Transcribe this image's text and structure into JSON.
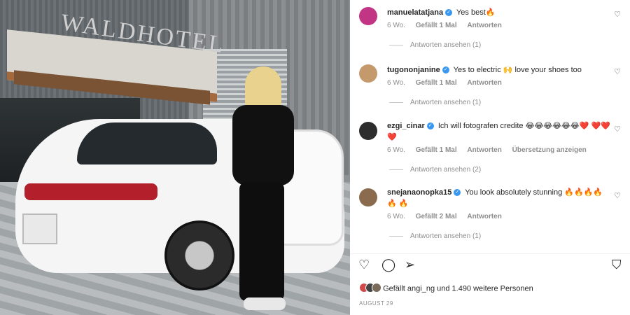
{
  "photo": {
    "sign_text": "WALDHOTEL"
  },
  "comments": [
    {
      "username": "manuelatatjana",
      "verified": true,
      "text": "Yes best🔥",
      "time": "6 Wo.",
      "likes": "Gefällt 1 Mal",
      "reply": "Antworten",
      "translate": "",
      "view_replies": "Antworten ansehen (1)",
      "avatar_color": "#c13584"
    },
    {
      "username": "tugononjanine",
      "verified": true,
      "text": "Yes to electric 🙌 love your shoes too",
      "time": "6 Wo.",
      "likes": "Gefällt 1 Mal",
      "reply": "Antworten",
      "translate": "",
      "view_replies": "Antworten ansehen (1)",
      "avatar_color": "#c49a6c"
    },
    {
      "username": "ezgi_cinar",
      "verified": true,
      "text": "Ich will fotografen credite 😂😂😂😂😂😂❤️ ❤️❤️❤️",
      "time": "6 Wo.",
      "likes": "Gefällt 1 Mal",
      "reply": "Antworten",
      "translate": "Übersetzung anzeigen",
      "view_replies": "Antworten ansehen (2)",
      "avatar_color": "#2d2d2d"
    },
    {
      "username": "snejanaonopka15",
      "verified": true,
      "text": "You look absolutely stunning 🔥🔥🔥🔥🔥 🔥",
      "time": "6 Wo.",
      "likes": "Gefällt 2 Mal",
      "reply": "Antworten",
      "translate": "",
      "view_replies": "Antworten ansehen (1)",
      "avatar_color": "#8a6b4e"
    }
  ],
  "likes_text": "Gefällt angi_ng und 1.490 weitere Personen",
  "date": "AUGUST 29",
  "icons": {
    "like": "heart-icon",
    "comment": "comment-icon",
    "share": "share-icon",
    "save": "bookmark-icon"
  },
  "colors": {
    "verified": "#3897f0",
    "muted": "#8e8e8e"
  }
}
